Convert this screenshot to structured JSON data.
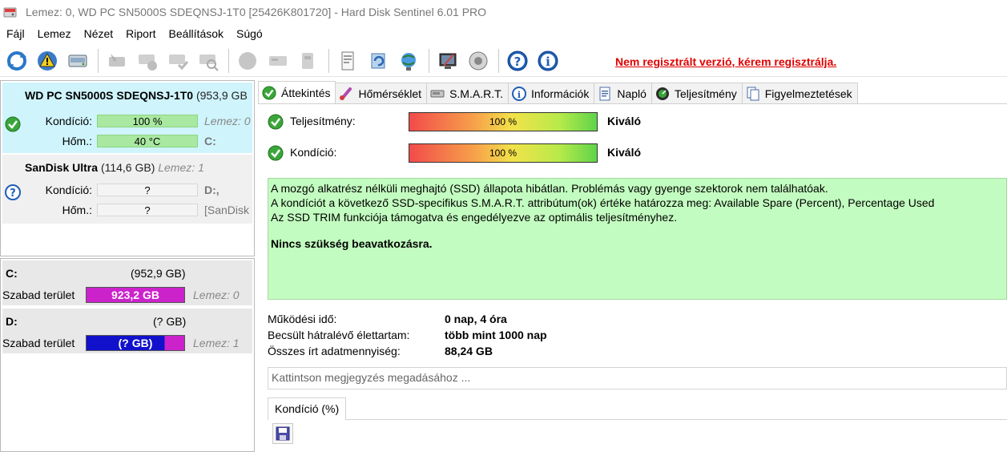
{
  "window": {
    "title": "Lemez: 0, WD PC SN5000S SDEQNSJ-1T0 [25426K801720]  -  Hard Disk Sentinel 6.01 PRO"
  },
  "menu": [
    "Fájl",
    "Lemez",
    "Nézet",
    "Riport",
    "Beállítások",
    "Súgó"
  ],
  "toolbar": {
    "nag_text": "Nem regisztrált verzió, kérem regisztrálja."
  },
  "disks": [
    {
      "name": "WD PC SN5000S SDEQNSJ-1T0",
      "capacity": "(953,9 GB",
      "health_label": "Kondíció:",
      "health_value": "100 %",
      "temp_label": "Hőm.:",
      "temp_value": "40 °C",
      "disk_ref": "Lemez: 0",
      "drive_letter": "C:"
    },
    {
      "name": "SanDisk Ultra",
      "capacity": "(114,6 GB)",
      "disk_ref": "Lemez: 1",
      "health_label": "Kondíció:",
      "health_value": "?",
      "temp_label": "Hőm.:",
      "temp_value": "?",
      "drive_letter": "D:,",
      "extra": "[SanDisk"
    }
  ],
  "volumes": [
    {
      "name": "C:",
      "size": "(952,9 GB)",
      "free_label": "Szabad terület",
      "free_value": "923,2 GB",
      "disk_ref": "Lemez: 0",
      "free_color": "#cc22cc"
    },
    {
      "name": "D:",
      "size": "(? GB)",
      "free_label": "Szabad terület",
      "free_value": "(? GB)",
      "disk_ref": "Lemez: 1",
      "free_color": "#1111cc"
    }
  ],
  "tabs": [
    "Áttekintés",
    "Hőmérséklet",
    "S.M.A.R.T.",
    "Információk",
    "Napló",
    "Teljesítmény",
    "Figyelmeztetések"
  ],
  "active_tab": "Áttekintés",
  "overview": {
    "performance": {
      "label": "Teljesítmény:",
      "value": "100 %",
      "rating": "Kiváló",
      "percent": 100
    },
    "health": {
      "label": "Kondíció:",
      "value": "100 %",
      "rating": "Kiváló",
      "percent": 100
    },
    "summary_lines": [
      "A mozgó alkatrész nélküli meghajtó (SSD) állapota hibátlan. Problémás vagy gyenge szektorok nem találhatóak.",
      "A kondíciót a következő SSD-specifikus S.M.A.R.T. attribútum(ok) értéke határozza meg:  Available Spare (Percent), Percentage Used",
      "Az SSD TRIM funkciója támogatva és engedélyezve az optimális teljesítményhez."
    ],
    "summary_bold": "Nincs szükség beavatkozásra.",
    "stats": [
      {
        "label": "Működési idő:",
        "value": "0 nap, 4 óra"
      },
      {
        "label": "Becsült hátralévő élettartam:",
        "value": "több mint 1000 nap"
      },
      {
        "label": "Összes írt adatmennyiség:",
        "value": "88,24 GB"
      }
    ],
    "note_placeholder": "Kattintson megjegyzés megadásához ...",
    "chart_tab": "Kondíció  (%)"
  }
}
